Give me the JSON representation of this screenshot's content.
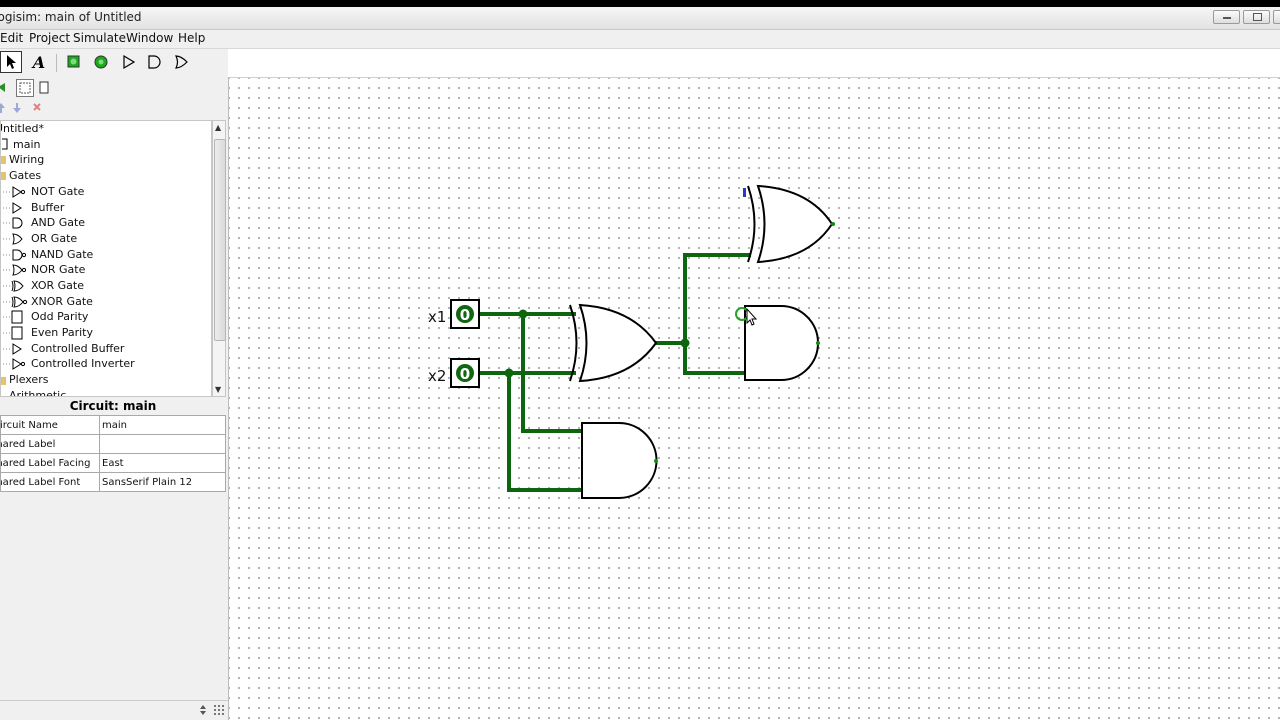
{
  "window": {
    "title": "Logisim: main of Untitled",
    "controls": [
      "minimize",
      "maximize",
      "close"
    ]
  },
  "menu": [
    "Edit",
    "Project",
    "Simulate",
    "Window",
    "Help"
  ],
  "toolbar": {
    "tools": [
      "pointer-tool",
      "text-tool",
      "input-pin-tool",
      "output-pin-tool",
      "not-gate-tool",
      "and-gate-tool",
      "or-gate-tool"
    ],
    "text_tool_glyph": "A"
  },
  "explorer": {
    "project": "Untitled*",
    "circuit": "main",
    "libraries": [
      "Wiring",
      "Gates"
    ],
    "gates": [
      "NOT Gate",
      "Buffer",
      "AND Gate",
      "OR Gate",
      "NAND Gate",
      "NOR Gate",
      "XOR Gate",
      "XNOR Gate",
      "Odd Parity",
      "Even Parity",
      "Controlled Buffer",
      "Controlled Inverter"
    ],
    "more_libraries": [
      "Plexers",
      "Arithmetic"
    ]
  },
  "attributes": {
    "title": "Circuit: main",
    "rows": [
      {
        "name": "Circuit Name",
        "value": "main"
      },
      {
        "name": "Shared Label",
        "value": ""
      },
      {
        "name": "Shared Label Facing",
        "value": "East"
      },
      {
        "name": "Shared Label Font",
        "value": "SansSerif Plain 12"
      }
    ]
  },
  "circuit": {
    "inputs": [
      {
        "label": "x1",
        "value": "0"
      },
      {
        "label": "x2",
        "value": "0"
      }
    ],
    "gates": [
      "xor-gate",
      "and-gate",
      "xor-gate",
      "and-gate"
    ],
    "wire_color": "#0d660d",
    "pin_color": "#116611"
  }
}
